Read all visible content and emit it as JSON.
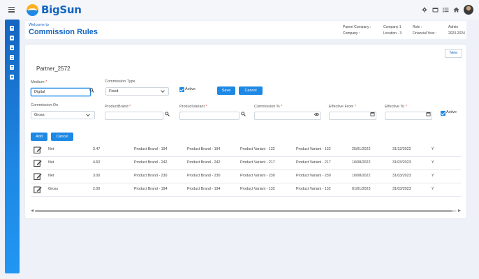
{
  "app": {
    "name": "BigSun"
  },
  "header": {
    "welcome": "Welcome to",
    "title": "Commission Rules",
    "parent_company_label": "Parent Company :",
    "company_label": "Company :",
    "company_value": "Company 1",
    "location_value": "Location - 3",
    "role_label": "Role :",
    "financial_year_label": "Financial Year :",
    "role_value": "Admin",
    "financial_year_value": "2023-2024"
  },
  "card": {
    "new_label": "New",
    "partner": "Partner_2572"
  },
  "form": {
    "medium_label": "Medium",
    "medium_value": "Digital",
    "commission_type_label": "Commission Type",
    "commission_type_value": "Fixed",
    "active_label": "Active",
    "save_label": "Save",
    "cancel_label": "Cancel",
    "commission_on_label": "Commission On",
    "commission_on_value": "Gross",
    "product_brand_label": "ProductBrand",
    "product_variant_label": "ProductVariant",
    "commission_pct_label": "Commission %",
    "effective_from_label": "Effective From",
    "effective_to_label": "Effective To",
    "active2_label": "Active",
    "add_label": "Add",
    "cancel2_label": "Cancel",
    "required_mark": "*"
  },
  "rows": [
    {
      "on": "Net",
      "pct": "3.47",
      "brand_from": "Product Brand - 194",
      "brand_to": "Product Brand - 194",
      "variant_from": "Product Variant - 132",
      "variant_to": "Product Variant - 132",
      "from": "25/01/2022",
      "to": "31/12/2022",
      "active": "Y"
    },
    {
      "on": "Net",
      "pct": "4.60",
      "brand_from": "Product Brand - 242",
      "brand_to": "Product Brand - 242",
      "variant_from": "Product Variant - 217",
      "variant_to": "Product Variant - 217",
      "from": "10/08/2022",
      "to": "31/03/2023",
      "active": "Y"
    },
    {
      "on": "Net",
      "pct": "3.00",
      "brand_from": "Product Brand - 230",
      "brand_to": "Product Brand - 230",
      "variant_from": "Product Variant - 230",
      "variant_to": "Product Variant - 230",
      "from": "10/08/2022",
      "to": "31/03/2023",
      "active": "Y"
    },
    {
      "on": "Gross",
      "pct": "2.00",
      "brand_from": "Product Brand - 194",
      "brand_to": "Product Brand - 194",
      "variant_from": "Product Variant - 132",
      "variant_to": "Product Variant - 132",
      "from": "01/01/2023",
      "to": "31/03/2023",
      "active": "Y"
    }
  ],
  "icons": {
    "hamburger": "hamburger-menu-icon",
    "settings": "gear-icon",
    "calendar": "calendar-icon",
    "list": "list-icon",
    "home": "home-icon",
    "search": "search-icon",
    "edit": "edit-icon",
    "visibility": "eye-icon"
  },
  "colors": {
    "primary": "#1e88e5",
    "title": "#1565c0",
    "accent": "#ffb020"
  }
}
